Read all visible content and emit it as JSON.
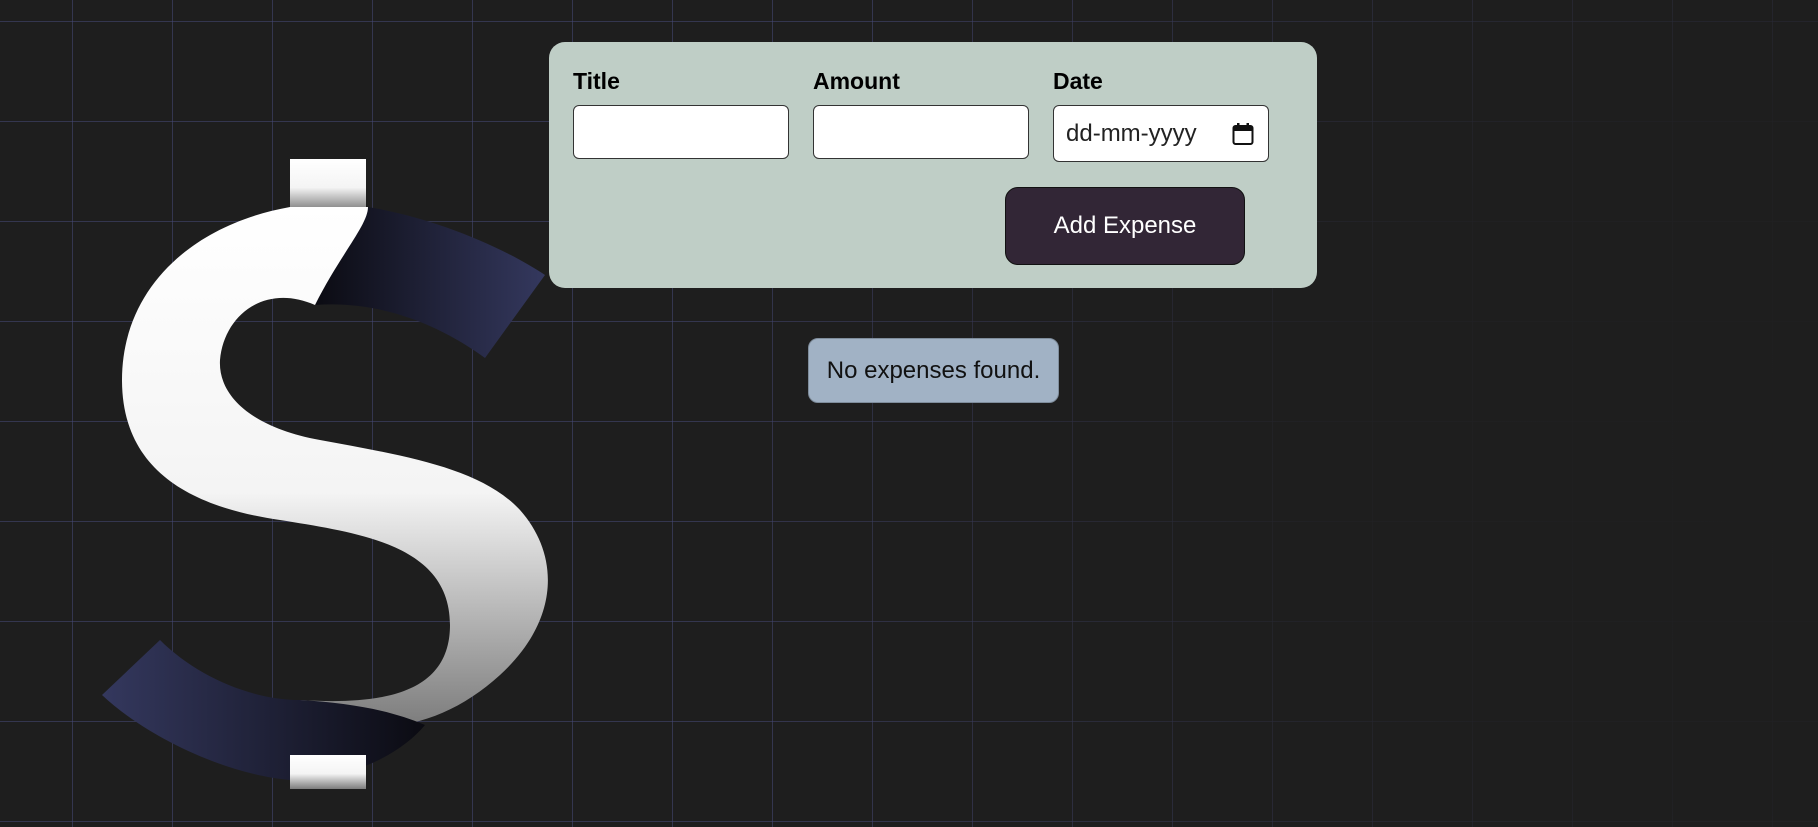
{
  "form": {
    "title_label": "Title",
    "title_value": "",
    "amount_label": "Amount",
    "amount_value": "",
    "date_label": "Date",
    "date_placeholder": "dd-mm-yyyy",
    "submit_label": "Add Expense"
  },
  "expenses": {
    "empty_message": "No expenses found."
  },
  "icons": {
    "logo": "dollar-sign-icon",
    "date_picker": "calendar-icon"
  },
  "colors": {
    "background": "#1e1e1e",
    "grid": "#464876",
    "form_panel": "#bfcec6",
    "button": "#322636",
    "empty_badge": "#a1b2c5"
  }
}
